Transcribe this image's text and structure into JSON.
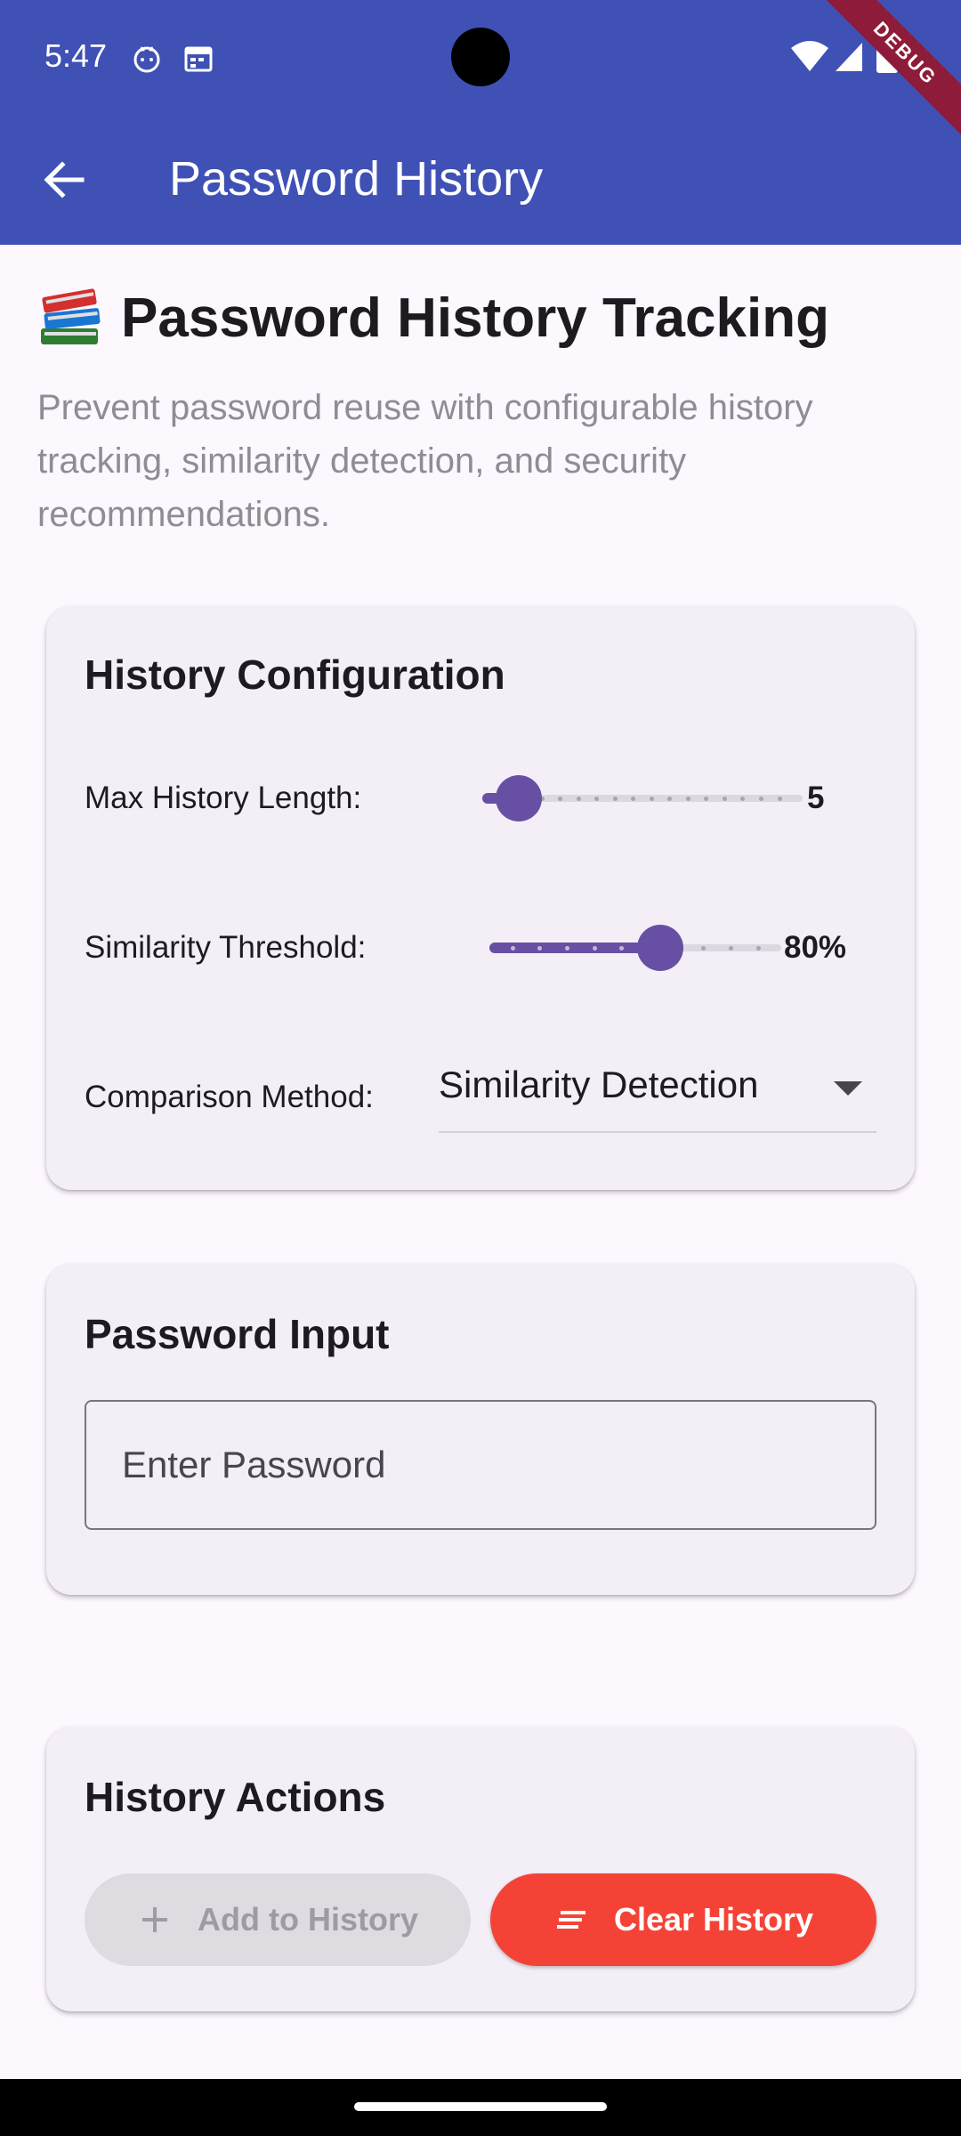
{
  "status_bar": {
    "time": "5:47"
  },
  "debug_banner": "DEBUG",
  "app_bar": {
    "title": "Password History"
  },
  "header": {
    "title": "Password History Tracking",
    "description": "Prevent password reuse with configurable history tracking, similarity detection, and security recommendations."
  },
  "history_configuration": {
    "title": "History Configuration",
    "max_history": {
      "label": "Max History Length:",
      "value": "5",
      "fraction": 0.05
    },
    "similarity_threshold": {
      "label": "Similarity Threshold:",
      "value": "80%",
      "fraction": 0.6
    },
    "comparison_method": {
      "label": "Comparison Method:",
      "selected": "Similarity Detection"
    }
  },
  "password_input": {
    "title": "Password Input",
    "placeholder": "Enter Password"
  },
  "history_actions": {
    "title": "History Actions",
    "add_label": "Add to History",
    "clear_label": "Clear History"
  },
  "colors": {
    "app_bar": "#3f51b5",
    "slider_active": "#6750a4",
    "clear_button": "#f44336",
    "debug_ribbon": "#8e1b3a"
  }
}
